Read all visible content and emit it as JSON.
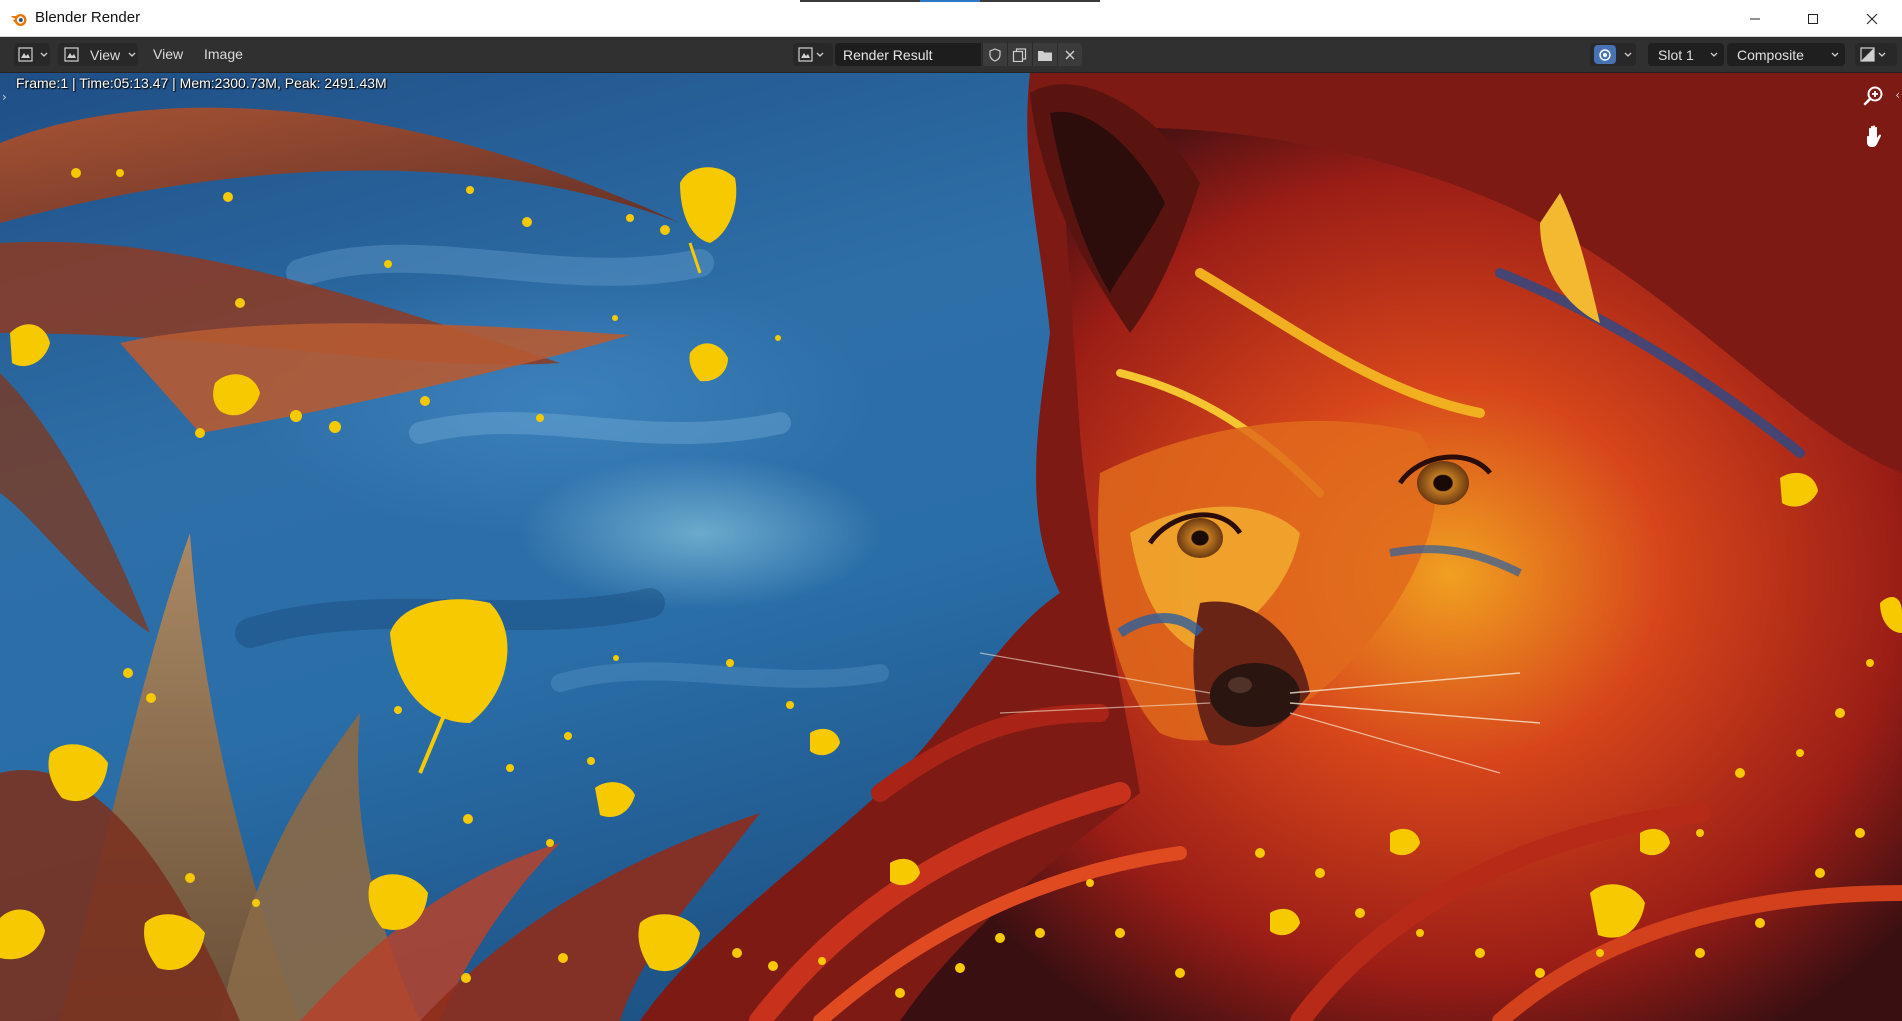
{
  "window": {
    "title": "Blender Render",
    "controls": [
      "minimize",
      "maximize",
      "close"
    ]
  },
  "header": {
    "editor_type_icon": "image-editor-icon",
    "view_mode_label": "View",
    "menus": [
      "View",
      "Image"
    ],
    "image_name": "Render Result",
    "image_buttons": [
      "shield-icon",
      "duplicate-image-icon",
      "open-folder-icon",
      "close-icon"
    ],
    "slot": "Slot 1",
    "layer": "Composite"
  },
  "viewport": {
    "render_stats": "Frame:1 | Time:05:13.47 | Mem:2300.73M, Peak: 2491.43M",
    "left_toggle": "›",
    "right_toggle": "‹",
    "gizmos": [
      "zoom-in-icon",
      "hand-pan-icon"
    ]
  },
  "colors": {
    "header_bg": "#303030",
    "field_bg": "#1d1d1d",
    "sky_blue": "#2e6fa8",
    "fur_red": "#c4281a",
    "flower_yellow": "#f6c900",
    "accent_blue": "#2f76c9"
  }
}
